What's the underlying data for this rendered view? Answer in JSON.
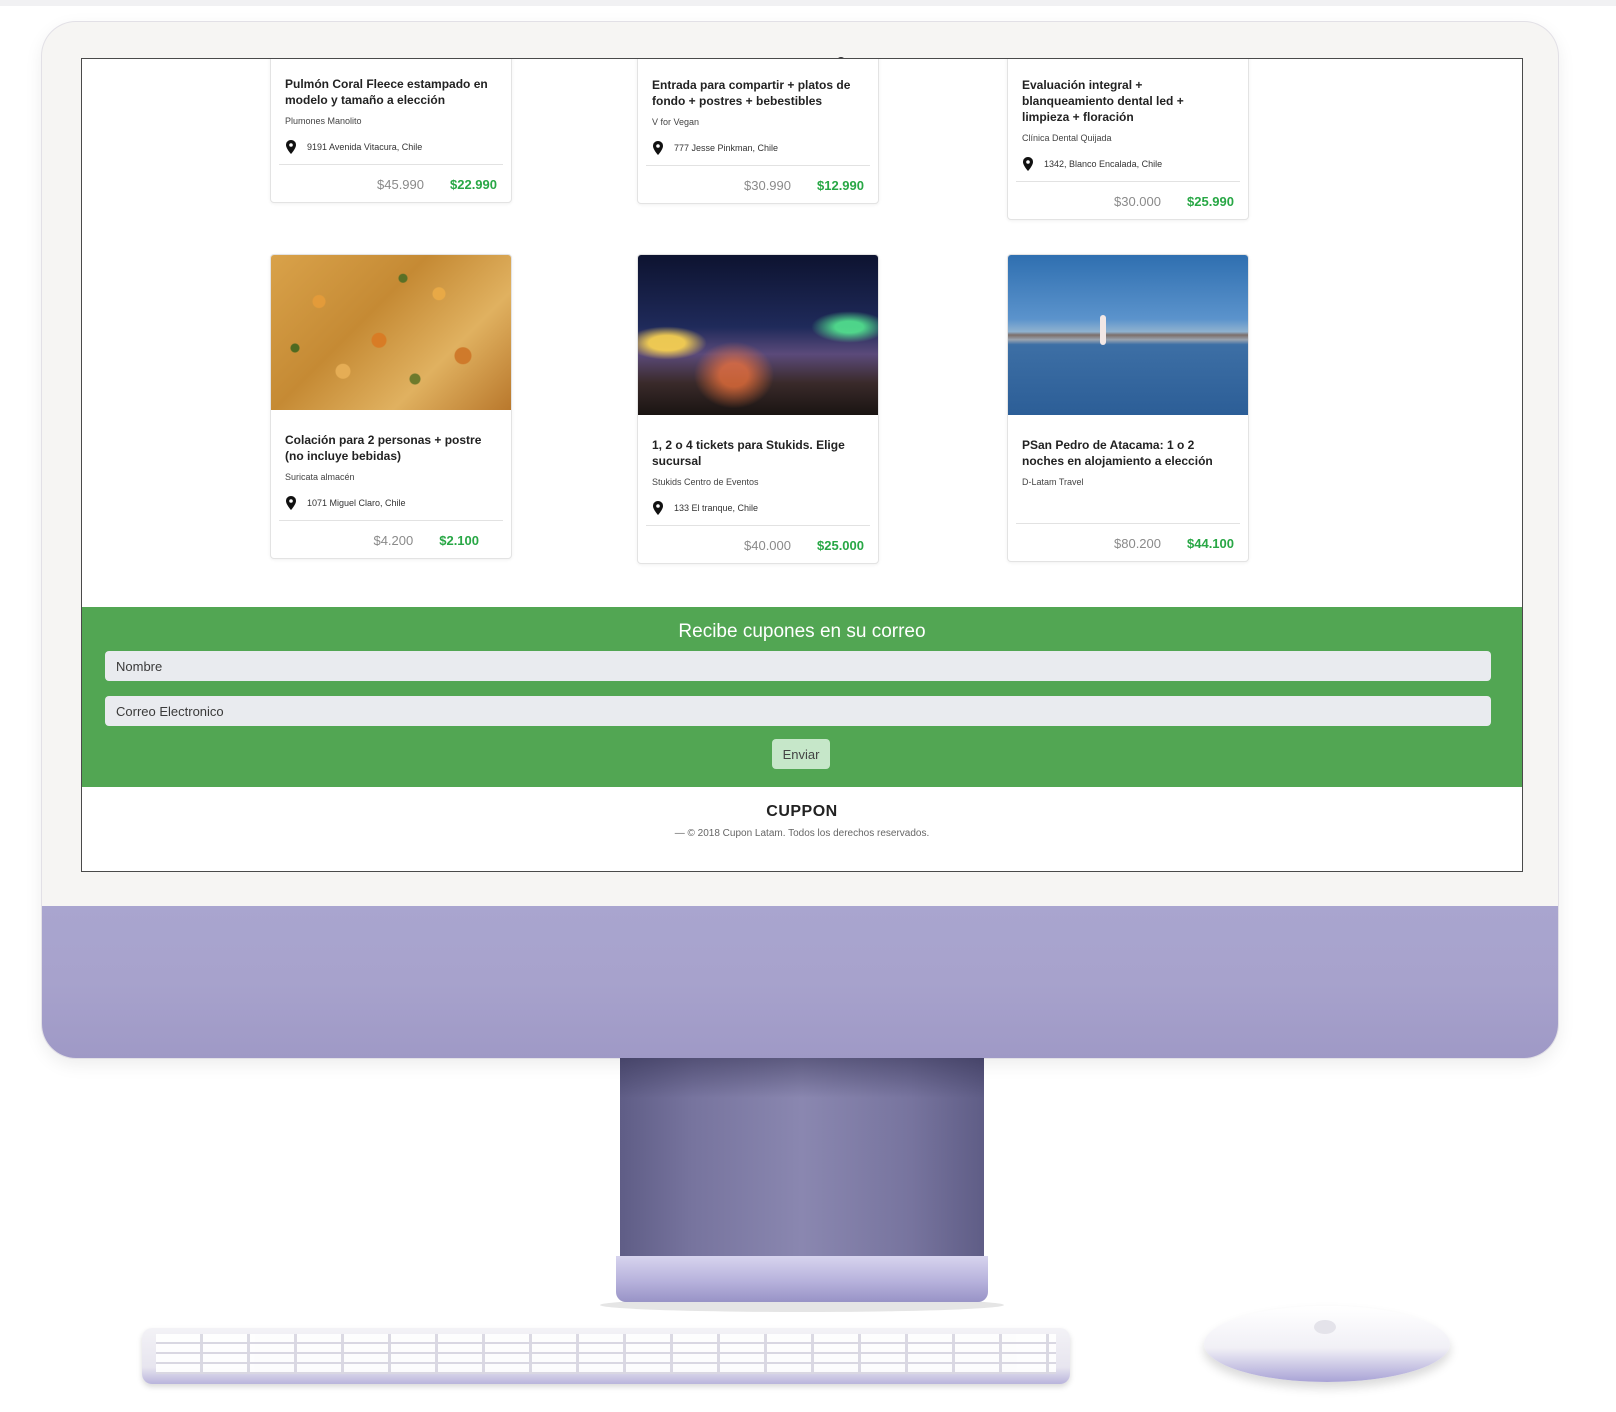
{
  "deals_row1": [
    {
      "title": "Pulmón Coral Fleece estampado en modelo y tamaño a elección",
      "vendor": "Plumones Manolito",
      "location": "9191 Avenida Vitacura, Chile",
      "old_price": "$45.990",
      "new_price": "$22.990"
    },
    {
      "title": "Entrada para compartir + platos de fondo + postres + bebestibles",
      "vendor": "V for Vegan",
      "location": "777 Jesse Pinkman, Chile",
      "old_price": "$30.990",
      "new_price": "$12.990"
    },
    {
      "title": "Evaluación integral + blanqueamiento dental led + limpieza + floración",
      "vendor": "Clínica Dental Quijada",
      "location": "1342, Blanco Encalada, Chile",
      "old_price": "$30.000",
      "new_price": "$25.990"
    }
  ],
  "deals_row2": [
    {
      "title": "Colación para 2 personas + postre (no incluye bebidas)",
      "vendor": "Suricata almacén",
      "location": "1071 Miguel Claro, Chile",
      "old_price": "$4.200",
      "new_price": "$2.100",
      "image": "food-photo"
    },
    {
      "title": "1, 2 o 4 tickets para Stukids. Elige sucursal",
      "vendor": "Stukids Centro de Eventos",
      "location": "133 El tranque, Chile",
      "old_price": "$40.000",
      "new_price": "$25.000",
      "image": "carnival-night-photo"
    },
    {
      "title": "PSan Pedro de Atacama: 1 o 2 noches en alojamiento a elección",
      "vendor": "D-Latam Travel",
      "old_price": "$80.200",
      "new_price": "$44.100",
      "image": "flamingo-lake-photo"
    }
  ],
  "newsletter": {
    "title": "Recibe cupones en su correo",
    "name_placeholder": "Nombre",
    "email_placeholder": "Correo Electronico",
    "submit_label": "Enviar"
  },
  "footer": {
    "brand": "CUPPON",
    "copyright": "— © 2018 Cupon Latam. Todos los derechos reservados."
  },
  "colors": {
    "accent_green": "#52a653",
    "price_green": "#28a745",
    "imac_purple": "#a7a2cc"
  }
}
